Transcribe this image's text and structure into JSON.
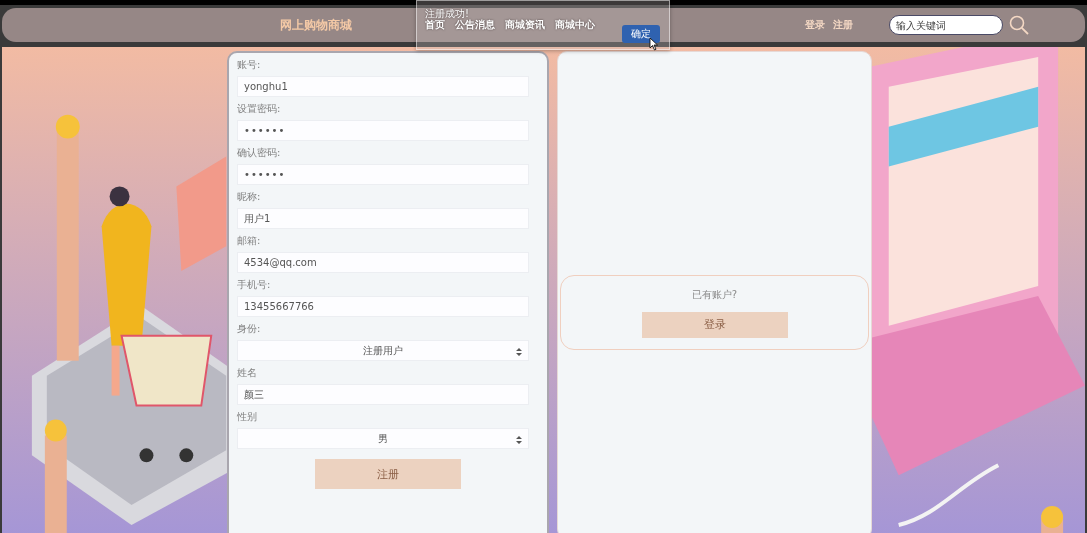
{
  "header": {
    "title": "网上购物商城",
    "nav": [
      "首页",
      "公告消息",
      "商城资讯",
      "商城中心"
    ],
    "auth_links": [
      "登录",
      "注册"
    ],
    "search": {
      "placeholder": "输入关键词"
    }
  },
  "dialog": {
    "message": "注册成功!",
    "button": "确定"
  },
  "register_form": {
    "fields": [
      {
        "label": "账号:",
        "kind": "text",
        "value": "yonghu1"
      },
      {
        "label": "设置密码:",
        "kind": "password",
        "value": "••••••"
      },
      {
        "label": "确认密码:",
        "kind": "password",
        "value": "••••••"
      },
      {
        "label": "昵称:",
        "kind": "text",
        "value": "用户1"
      },
      {
        "label": "邮箱:",
        "kind": "text",
        "value": "4534@qq.com"
      },
      {
        "label": "手机号:",
        "kind": "text",
        "value": "13455667766"
      },
      {
        "label": "身份:",
        "kind": "select",
        "value": "注册用户"
      },
      {
        "label": "姓名",
        "kind": "text",
        "value": "颜三"
      },
      {
        "label": "性别",
        "kind": "select",
        "value": "男"
      }
    ],
    "submit": "注册"
  },
  "login_prompt": {
    "text": "已有账户?",
    "button": "登录"
  }
}
